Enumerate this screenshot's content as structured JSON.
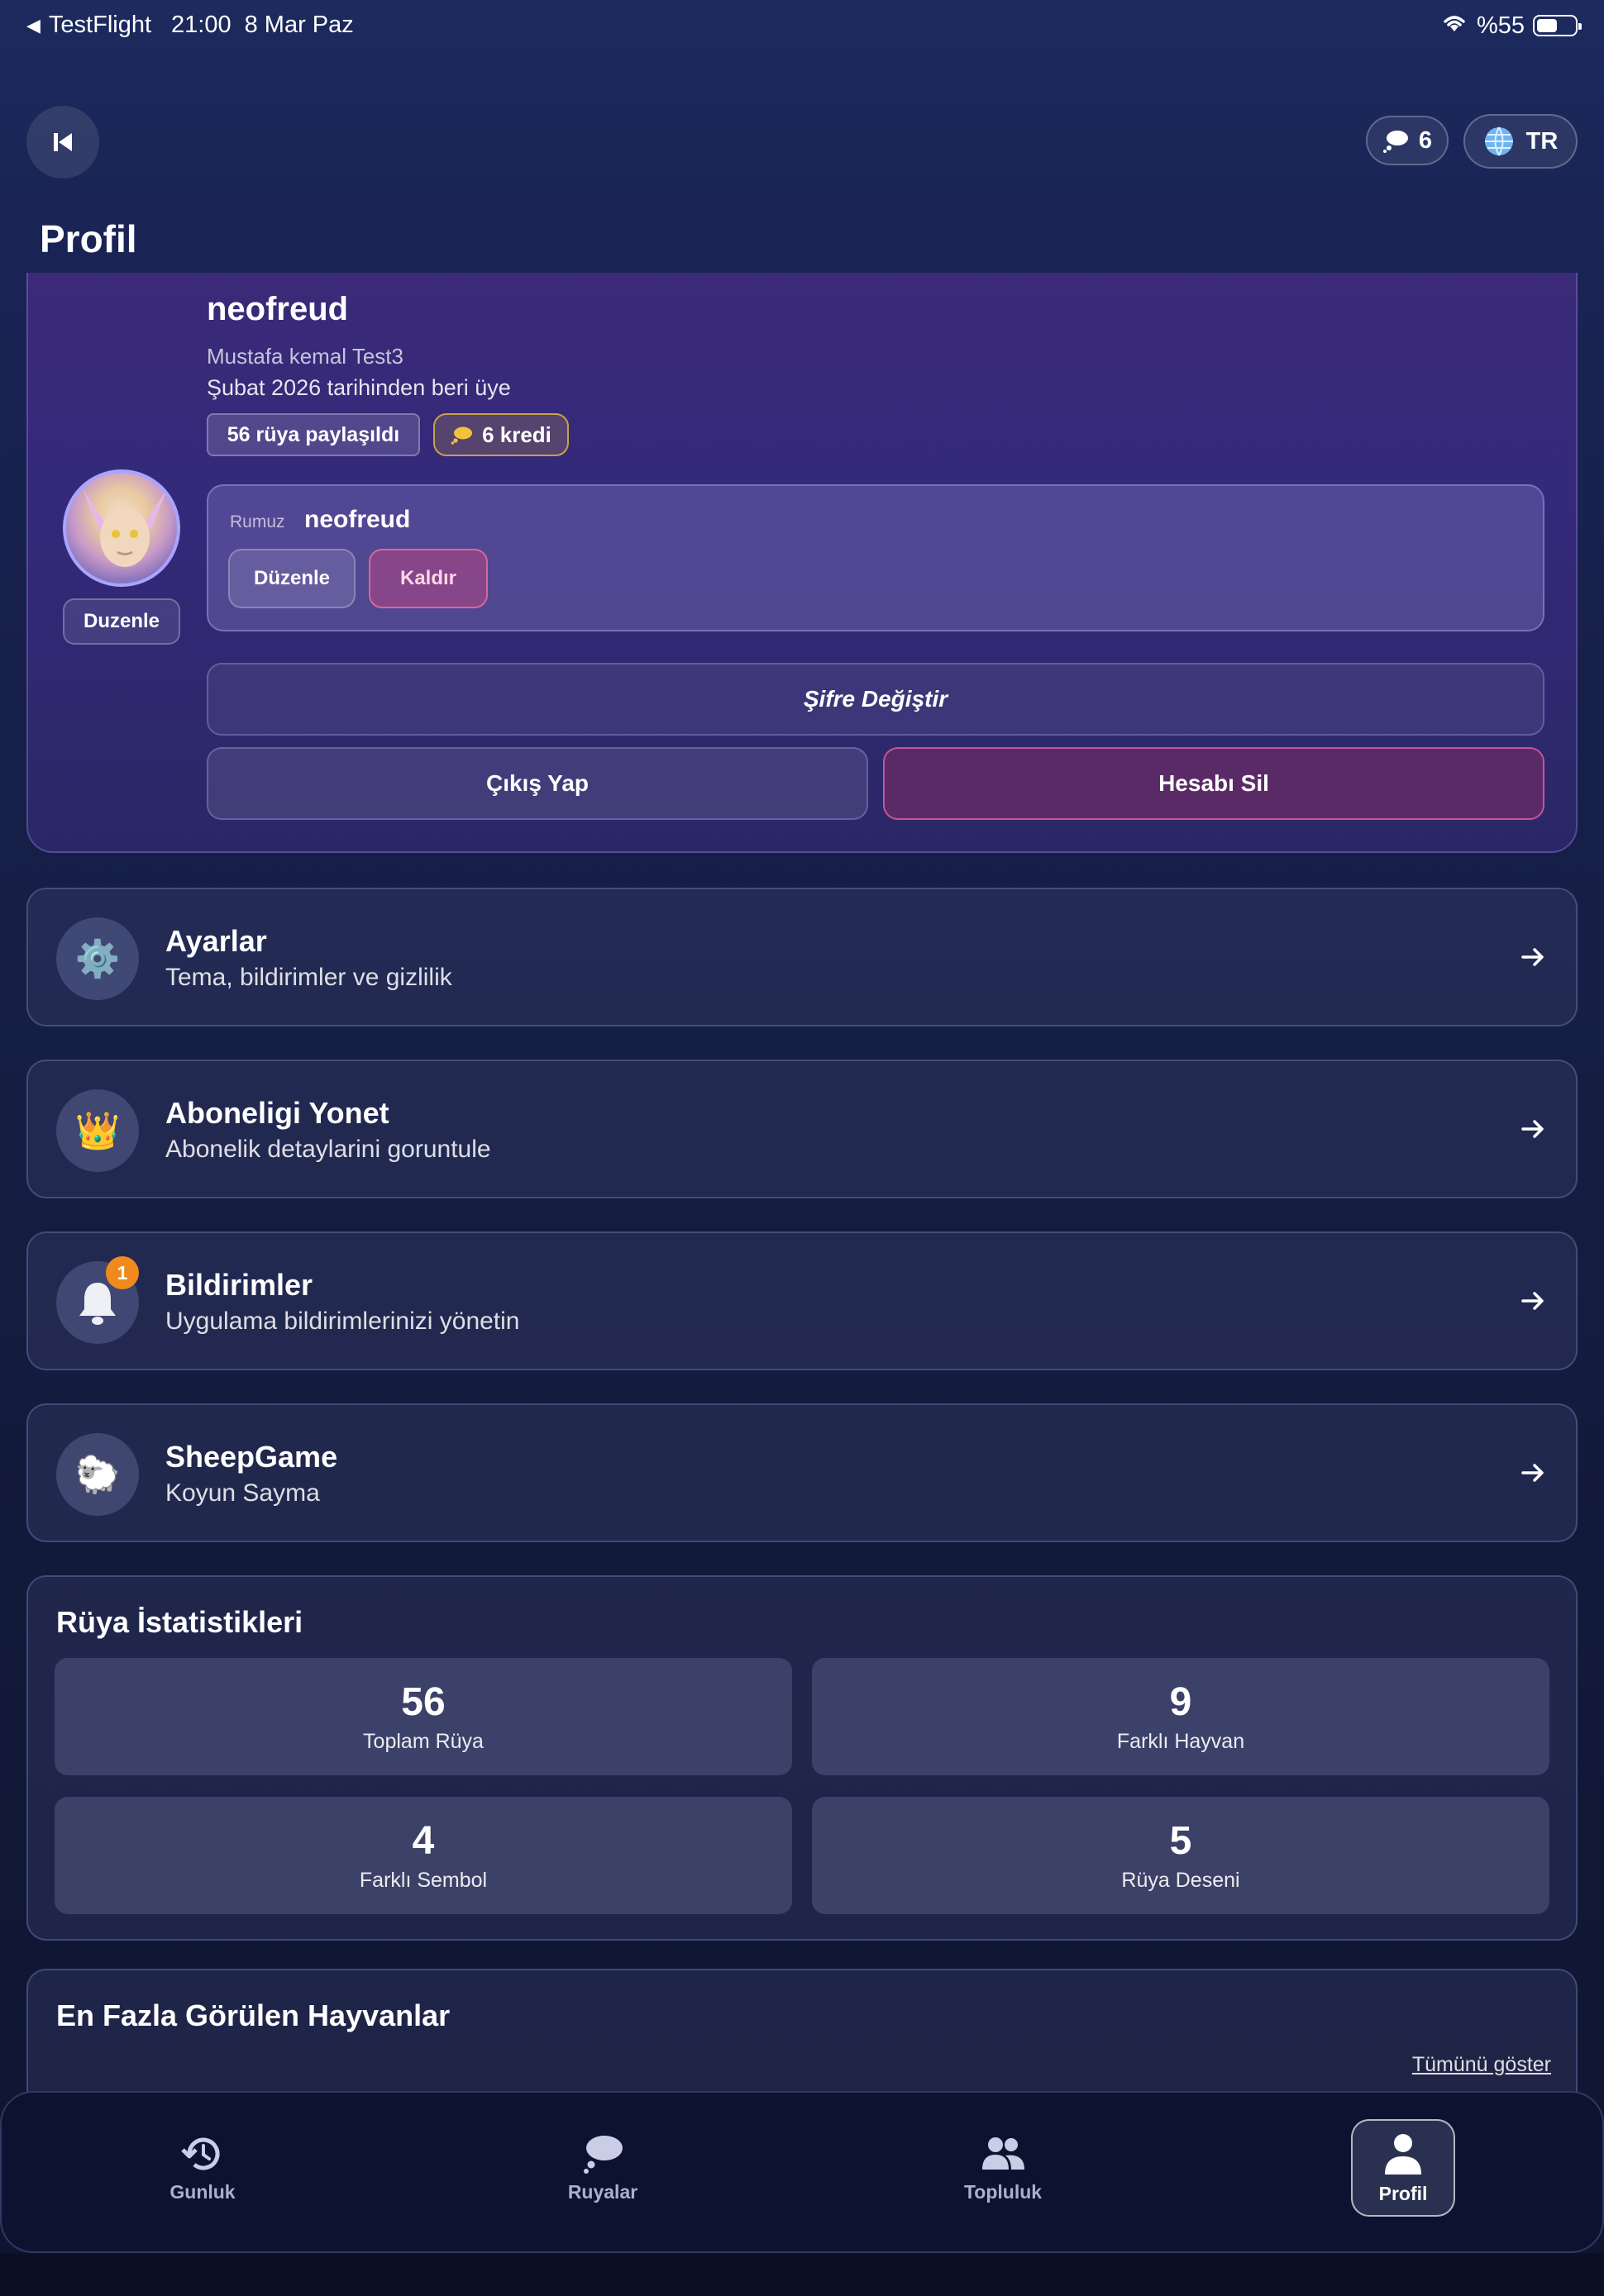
{
  "status_bar": {
    "app_back": "TestFlight",
    "time": "21:00",
    "date": "8 Mar Paz",
    "battery": "%55",
    "battery_level": 0.55
  },
  "header": {
    "credits_count": "6",
    "language": "TR",
    "title": "Profil"
  },
  "profile": {
    "username": "neofreud",
    "full_name": "Mustafa kemal Test3",
    "member_since": "Şubat 2026 tarihinden beri üye",
    "dreams_badge": "56 rüya paylaşıldı",
    "credits_badge": "6 kredi",
    "avatar_edit": "Duzenle",
    "nickname_label": "Rumuz",
    "nickname_value": "neofreud",
    "nickname_edit": "Düzenle",
    "nickname_remove": "Kaldır",
    "change_password": "Şifre Değiştir",
    "logout": "Çıkış Yap",
    "delete_account": "Hesabı Sil"
  },
  "menu": [
    {
      "icon": "gear-icon",
      "glyph": "⚙️",
      "title": "Ayarlar",
      "subtitle": "Tema, bildirimler ve gizlilik"
    },
    {
      "icon": "crown-icon",
      "glyph": "👑",
      "title": "Aboneligi Yonet",
      "subtitle": "Abonelik detaylarini goruntule"
    },
    {
      "icon": "bell-icon",
      "glyph": "🔔",
      "title": "Bildirimler",
      "subtitle": "Uygulama bildirimlerinizi yönetin",
      "badge": "1"
    },
    {
      "icon": "sheep-icon",
      "glyph": "🐑",
      "title": "SheepGame",
      "subtitle": "Koyun Sayma"
    }
  ],
  "stats": {
    "title": "Rüya İstatistikleri",
    "items": [
      {
        "value": "56",
        "label": "Toplam Rüya"
      },
      {
        "value": "9",
        "label": "Farklı Hayvan"
      },
      {
        "value": "4",
        "label": "Farklı Sembol"
      },
      {
        "value": "5",
        "label": "Rüya Deseni"
      }
    ]
  },
  "animals": {
    "title": "En Fazla Görülen Hayvanlar",
    "show_all": "Tümünü göster"
  },
  "tabs": [
    {
      "label": "Gunluk",
      "icon": "history-icon"
    },
    {
      "label": "Ruyalar",
      "icon": "cloud-icon"
    },
    {
      "label": "Topluluk",
      "icon": "people-icon"
    },
    {
      "label": "Profil",
      "icon": "person-icon",
      "active": true
    }
  ],
  "colors": {
    "accent_purple": "#34297a",
    "danger": "#5a2a66",
    "badge_orange": "#f08a1c",
    "credit_gold": "#c9a14a"
  }
}
